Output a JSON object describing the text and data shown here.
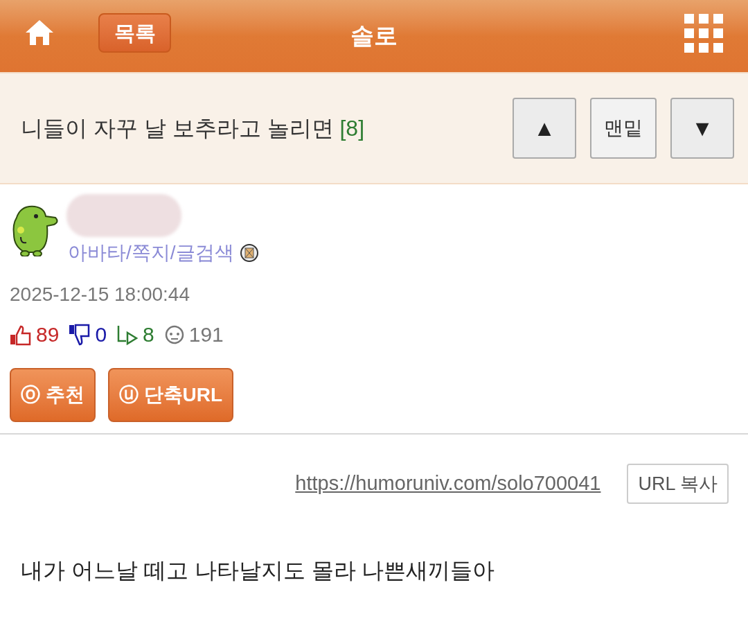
{
  "header": {
    "list_button": "목록",
    "title": "솔로"
  },
  "post": {
    "title": "니들이 자꾸 날 보추라고 놀리면",
    "comment_count": "[8]",
    "nav_buttons": [
      {
        "kind": "up",
        "label": "▲"
      },
      {
        "kind": "text",
        "label": "맨밑"
      },
      {
        "kind": "down",
        "label": "▼"
      }
    ]
  },
  "author": {
    "links": "아바타/쪽지/글검색",
    "date": "2025-12-15 18:00:44"
  },
  "stats": [
    {
      "kind": "like",
      "value": "89",
      "color": "#c62828"
    },
    {
      "kind": "dislike",
      "value": "0",
      "color": "#1a1aa8"
    },
    {
      "kind": "reply",
      "value": "8",
      "color": "#2e7d32"
    },
    {
      "kind": "views",
      "value": "191",
      "color": "#777777"
    }
  ],
  "actions": [
    {
      "icon": "ⓞ",
      "label": "추천"
    },
    {
      "icon": "ⓤ",
      "label": "단축URL"
    }
  ],
  "url": {
    "link": "https://humoruniv.com/solo700041",
    "copy_button": "URL 복사"
  },
  "body": "내가 어느날 떼고 나타날지도 몰라 나쁜새끼들아"
}
